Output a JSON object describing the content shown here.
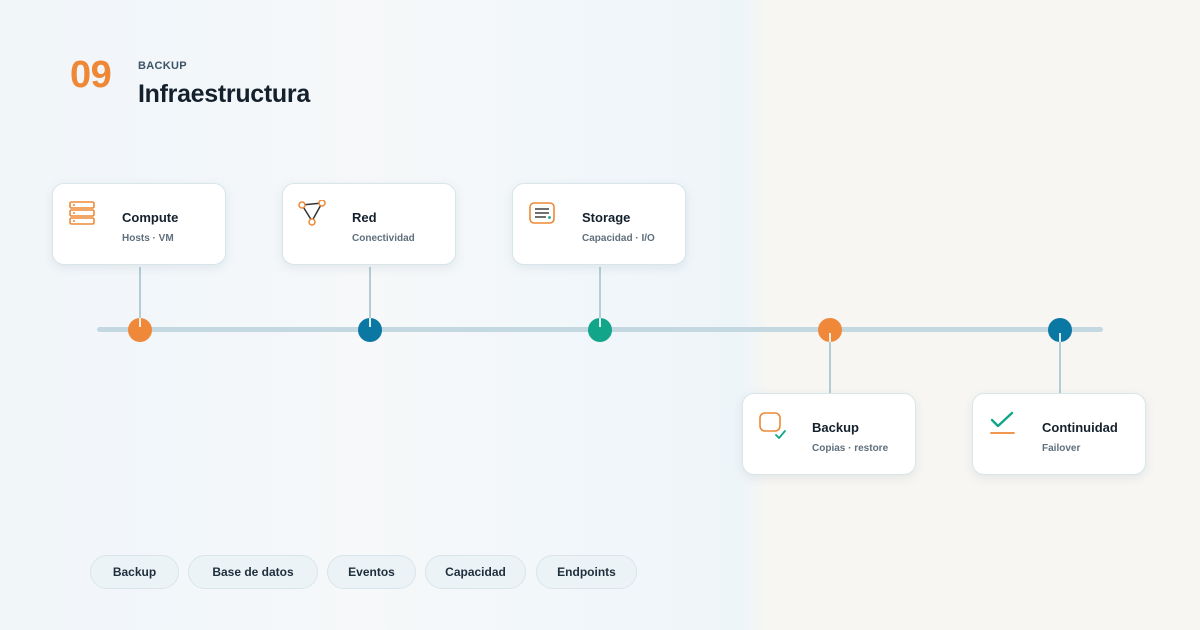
{
  "header": {
    "section_number": "09",
    "eyebrow": "BACKUP",
    "title": "Infraestructura"
  },
  "colors": {
    "orange": "#f0883a",
    "blue": "#0b78a3",
    "green": "#12a58a",
    "track": "#c3d8e0"
  },
  "timeline": {
    "nodes": [
      {
        "title": "Compute",
        "subtitle": "Hosts · VM",
        "icon": "server-icon",
        "dot_color": "orange",
        "side": "above"
      },
      {
        "title": "Red",
        "subtitle": "Conectividad",
        "icon": "network-icon",
        "dot_color": "blue",
        "side": "above"
      },
      {
        "title": "Storage",
        "subtitle": "Capacidad · I/O",
        "icon": "storage-icon",
        "dot_color": "green",
        "side": "above"
      },
      {
        "title": "Backup",
        "subtitle": "Copias · restore",
        "icon": "backup-icon",
        "dot_color": "orange",
        "side": "below"
      },
      {
        "title": "Continuidad",
        "subtitle": "Failover",
        "icon": "checkmark-icon",
        "dot_color": "blue",
        "side": "below"
      }
    ]
  },
  "tags": [
    "Backup",
    "Base de datos",
    "Eventos",
    "Capacidad",
    "Endpoints"
  ]
}
